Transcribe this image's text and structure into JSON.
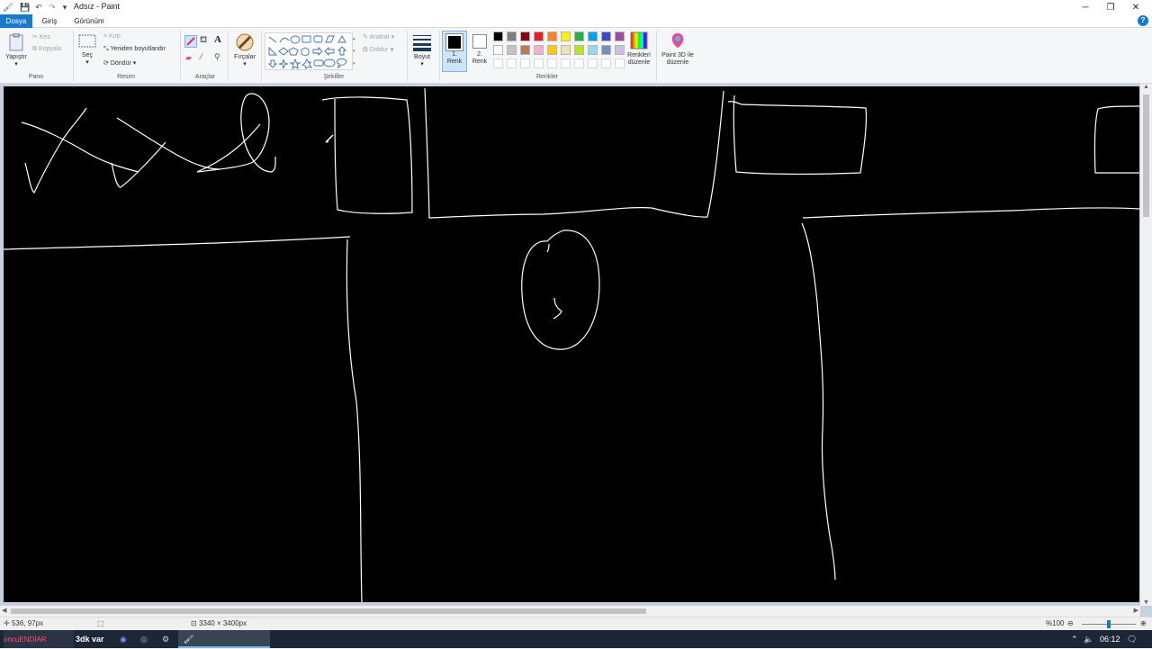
{
  "window": {
    "title": "Adsız - Paint",
    "controls": {
      "minimize": "─",
      "maximize": "❐",
      "close": "✕"
    }
  },
  "tabs": [
    {
      "label": "Dosya"
    },
    {
      "label": "Giriş"
    },
    {
      "label": "Görünüm"
    }
  ],
  "help_label": "?",
  "ribbon": {
    "clipboard": {
      "paste": "Yapıştır",
      "cut": "Kes",
      "copy": "Kopyala",
      "group": "Pano"
    },
    "image": {
      "select": "Seç",
      "crop": "Kırp",
      "resize": "Yeniden boyutlandır",
      "rotate": "Döndür",
      "group": "Resim"
    },
    "tools": {
      "group": "Araçlar",
      "text_tool": "A"
    },
    "brushes": {
      "label": "Fırçalar"
    },
    "shapes": {
      "outline": "Anahat",
      "fill": "Doldur",
      "group": "Şekiller"
    },
    "size": {
      "label": "Boyut"
    },
    "color1": {
      "label_1": "1.",
      "label_2": "Renk"
    },
    "color2": {
      "label_1": "2.",
      "label_2": "Renk"
    },
    "edit_colors": {
      "label_1": "Renkleri",
      "label_2": "düzenle"
    },
    "paint3d": {
      "label_1": "Paint 3D ile",
      "label_2": "düzenle"
    },
    "colors_group": "Renkler",
    "palette_row1": [
      "#000000",
      "#7f7f7f",
      "#880015",
      "#ed1c24",
      "#ff7f27",
      "#fff200",
      "#22b14c",
      "#00a2e8",
      "#3f48cc",
      "#a349a4"
    ],
    "palette_row2": [
      "#ffffff",
      "#c3c3c3",
      "#b97a57",
      "#ffaec9",
      "#ffc90e",
      "#efe4b0",
      "#b5e61d",
      "#99d9ea",
      "#7092be",
      "#c8bfe7"
    ],
    "color1_value": "#000000",
    "color2_value": "#ffffff"
  },
  "status": {
    "cursor_pos": "536, 97px",
    "image_size": "3340 × 3400px",
    "zoom": "%100",
    "zoom_level_fraction": 0.5
  },
  "taskbar": {
    "app_text_1": "oncu",
    "app_text_2": "ENDİAR",
    "app_text_3": "3dk var",
    "time": "06:12"
  }
}
